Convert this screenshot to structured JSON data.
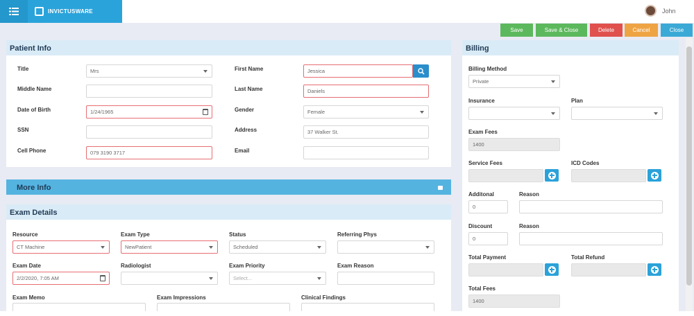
{
  "app": {
    "name": "INVICTUSWARE"
  },
  "user": {
    "name": "John"
  },
  "actions": {
    "save": "Save",
    "save_close": "Save & Close",
    "delete": "Delete",
    "cancel": "Cancel",
    "close": "Close"
  },
  "colors": {
    "brand": "#2aa3db",
    "save": "#5cb85c",
    "delete": "#e0504c",
    "cancel": "#efa443",
    "close": "#3aa9d6",
    "required_border": "#e66d72"
  },
  "patient": {
    "title": "Patient Info",
    "title_label": "Title",
    "title_value": "Mrs",
    "first_name_label": "First Name",
    "first_name": "Jessica",
    "middle_name_label": "Middle Name",
    "middle_name": "",
    "last_name_label": "Last Name",
    "last_name": "Daniels",
    "dob_label": "Date of Birth",
    "dob": "1/24/1965",
    "gender_label": "Gender",
    "gender": "Female",
    "ssn_label": "SSN",
    "ssn": "",
    "address_label": "Address",
    "address": "37 Walker St.",
    "cell_label": "Cell Phone",
    "cell": "079 3190 3717",
    "email_label": "Email",
    "email": ""
  },
  "more_info": {
    "title": "More Info"
  },
  "exam": {
    "title": "Exam Details",
    "resource_label": "Resource",
    "resource": "CT Machine",
    "exam_type_label": "Exam Type",
    "exam_type": "NewPatient",
    "status_label": "Status",
    "status": "Scheduled",
    "referring_label": "Referring Phys",
    "referring": "",
    "exam_date_label": "Exam Date",
    "exam_date": "2/2/2020, 7:05 AM",
    "radiologist_label": "Radiologist",
    "radiologist": "",
    "priority_label": "Exam Priority",
    "priority_placeholder": "Select...",
    "reason_label": "Exam Reason",
    "reason": "",
    "memo_label": "Exam Memo",
    "impressions_label": "Exam Impressions",
    "findings_label": "Clinical Findings"
  },
  "billing": {
    "title": "Billing",
    "method_label": "Billing Method",
    "method": "Private",
    "insurance_label": "Insurance",
    "insurance": "",
    "plan_label": "Plan",
    "plan": "",
    "exam_fees_label": "Exam Fees",
    "exam_fees": "1400",
    "service_fees_label": "Service Fees",
    "icd_label": "ICD Codes",
    "additional_label": "Additonal",
    "additional": "0",
    "reason1_label": "Reason",
    "discount_label": "Discount",
    "discount": "0",
    "reason2_label": "Reason",
    "total_payment_label": "Total Payment",
    "total_refund_label": "Total Refund",
    "total_fees_label": "Total Fees",
    "total_fees": "1400"
  }
}
